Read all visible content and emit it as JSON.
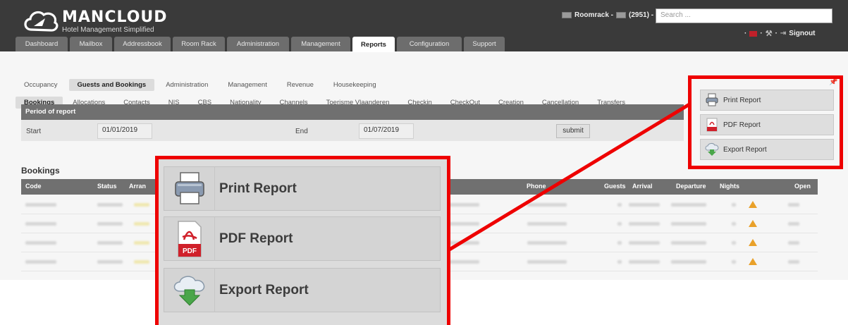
{
  "brand": {
    "name": "MANCLOUD",
    "tagline": "Hotel Management Simplified"
  },
  "header": {
    "roomrack": "Roomrack -",
    "count": "(2951) -",
    "search_placeholder": "Search ...",
    "signout": "Signout"
  },
  "main_nav": [
    "Dashboard",
    "Mailbox",
    "Addressbook",
    "Room Rack",
    "Administration",
    "Management",
    "Reports",
    "Configuration",
    "Support"
  ],
  "main_nav_active": "Reports",
  "sub_nav": [
    "Occupancy",
    "Guests and Bookings",
    "Administration",
    "Management",
    "Revenue",
    "Housekeeping"
  ],
  "sub_nav2": [
    "Bookings",
    "Allocations",
    "Contacts",
    "NIS",
    "CBS",
    "Nationality",
    "Channels",
    "Toerisme Vlaanderen",
    "Checkin",
    "CheckOut",
    "Creation",
    "Cancellation",
    "Transfers"
  ],
  "period": {
    "title": "Period of report",
    "start_label": "Start",
    "start_value": "01/01/2019",
    "end_label": "End",
    "end_value": "01/07/2019",
    "submit": "submit"
  },
  "bookings": {
    "title": "Bookings",
    "columns": [
      "Code",
      "Status",
      "Arran",
      "Phone",
      "Guests",
      "Arrival",
      "Departure",
      "Nights",
      "Open"
    ]
  },
  "report_actions": {
    "print": "Print Report",
    "pdf": "PDF Report",
    "pdf_icon_text": "PDF",
    "export": "Export Report"
  },
  "colors": {
    "header_bg": "#3a3a3a",
    "callout": "#ee0000",
    "table_head": "#707070"
  }
}
